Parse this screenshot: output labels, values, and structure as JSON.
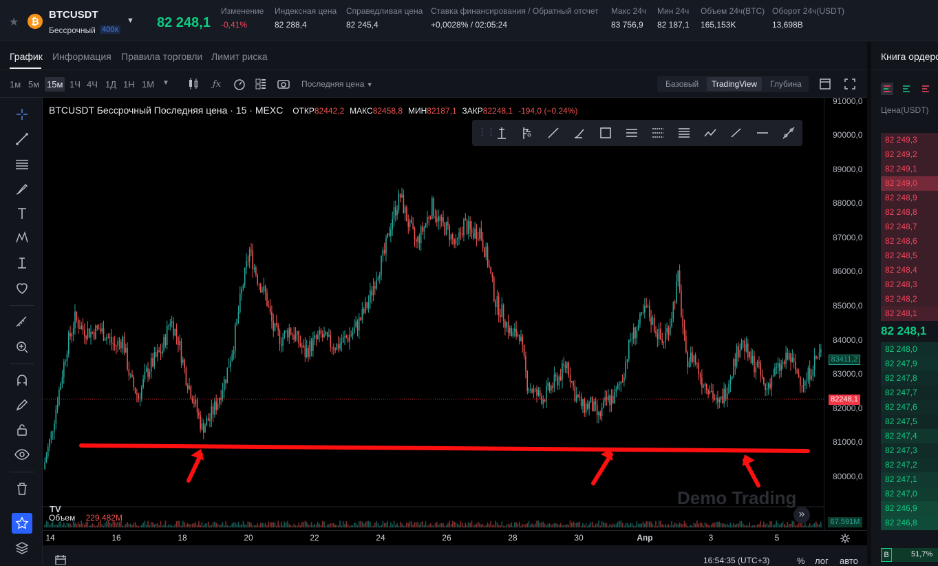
{
  "header": {
    "symbol": "BTCUSDT",
    "contract_type": "Бессрочный",
    "leverage": "400x",
    "last_price": "82 248,1",
    "stats": [
      {
        "label": "Изменение",
        "value": "-0,41%",
        "tone": "down"
      },
      {
        "label": "Индексная цена",
        "value": "82 288,4",
        "tone": "neutral"
      },
      {
        "label": "Справедливая цена",
        "value": "82 245,4",
        "tone": "neutral"
      },
      {
        "label": "Ставка финансирования / Обратный отсчет",
        "value": "+0,0028% / 02:05:24",
        "tone": "neutral"
      },
      {
        "label": "Макс 24ч",
        "value": "83 756,9",
        "tone": "neutral"
      },
      {
        "label": "Мин 24ч",
        "value": "82 187,1",
        "tone": "neutral"
      },
      {
        "label": "Объем 24ч(BTC)",
        "value": "165,153K",
        "tone": "neutral"
      },
      {
        "label": "Оборот 24ч(USDT)",
        "value": "13,698B",
        "tone": "neutral"
      }
    ]
  },
  "tabs": [
    "График",
    "Информация",
    "Правила торговли",
    "Лимит риска"
  ],
  "timeframes": [
    "1м",
    "5м",
    "15м",
    "1Ч",
    "4Ч",
    "1Д",
    "1Н",
    "1М"
  ],
  "price_source": "Последняя цена",
  "view_modes": [
    "Базовый",
    "TradingView",
    "Глубина"
  ],
  "legend": {
    "title": "BTCUSDT Бессрочный Последняя цена · 15 · MEXC",
    "open_label": "ОТКР",
    "open": "82442,2",
    "high_label": "МАКС",
    "high": "82458,8",
    "low_label": "МИН",
    "low": "82187,1",
    "close_label": "ЗАКР",
    "close": "82248,1",
    "change": "-194,0 (−0.24%)"
  },
  "volume_legend": {
    "label": "Объем",
    "value": "229.482M",
    "axis_tag": "67.591M"
  },
  "watermark": "Demo Trading",
  "price_axis": {
    "ticks": [
      "91000,0",
      "90000,0",
      "89000,0",
      "88000,0",
      "87000,0",
      "86000,0",
      "85000,0",
      "84000,0",
      "83000,0",
      "82000,0",
      "81000,0",
      "80000,0"
    ],
    "tag_green": "83411,2",
    "tag_red": "82248,1"
  },
  "time_axis": [
    "14",
    "16",
    "18",
    "20",
    "22",
    "24",
    "26",
    "28",
    "30",
    "Апр",
    "3",
    "5"
  ],
  "bottom": {
    "time": "16:54:35 (UTC+3)",
    "percent": "%",
    "log": "лог",
    "auto": "авто"
  },
  "orderbook": {
    "title": "Книга ордеров",
    "column": "Цена(USDT)",
    "asks": [
      "82 249,3",
      "82 249,2",
      "82 249,1",
      "82 249,0",
      "82 248,9",
      "82 248,8",
      "82 248,7",
      "82 248,6",
      "82 248,5",
      "82 248,4",
      "82 248,3",
      "82 248,2",
      "82 248,1"
    ],
    "mid": "82 248,1",
    "bids": [
      "82 248,0",
      "82 247,9",
      "82 247,8",
      "82 247,7",
      "82 247,6",
      "82 247,5",
      "82 247,4",
      "82 247,3",
      "82 247,2",
      "82 247,1",
      "82 247,0",
      "82 246,9",
      "82 246,8"
    ],
    "footer_letter": "B",
    "footer_pct": "51,7%"
  },
  "chart_data": {
    "type": "candlestick",
    "ylim": [
      79000,
      91500
    ],
    "x_ticks": [
      "14",
      "16",
      "18",
      "20",
      "22",
      "24",
      "26",
      "28",
      "30",
      "Апр",
      "3",
      "5"
    ],
    "series": [
      {
        "values": [
          80200,
          81200,
          82500,
          83800,
          84600,
          84300,
          84200,
          84300,
          84100,
          83800,
          84000,
          82800,
          82300,
          83000,
          83400,
          83700,
          84600,
          84000,
          82900,
          82200,
          81400,
          81700,
          82200,
          82900,
          83900,
          85400,
          86600,
          85800,
          85300,
          84300,
          84000,
          84300,
          84000,
          83600,
          83900,
          84100,
          83900,
          83800,
          84000,
          84200,
          84600,
          85100,
          85900,
          86500,
          87600,
          88200,
          87400,
          86800,
          87300,
          87900,
          87400,
          87200,
          86700,
          87400,
          87100,
          87200,
          86300,
          85100,
          84700,
          84100,
          84200,
          82700,
          82400,
          82300,
          82600,
          82900,
          83300,
          82400,
          82000,
          82100,
          81700,
          82200,
          82300,
          82900,
          84000,
          84400,
          84900,
          84400,
          83900,
          84500,
          85800,
          83400,
          83500,
          82800,
          82600,
          82000,
          82500,
          83300,
          84000,
          83400,
          83200,
          82500,
          83000,
          83200,
          83500,
          83000,
          82700,
          83300,
          83600
        ]
      }
    ],
    "support_line_price": 80800,
    "colors": {
      "up": "#26a69a",
      "down": "#ef5350",
      "annotation": "#ff1010"
    }
  },
  "colors": {
    "up": "#0ecb81",
    "down": "#f6465d",
    "accent_orange": "#f7931a"
  }
}
